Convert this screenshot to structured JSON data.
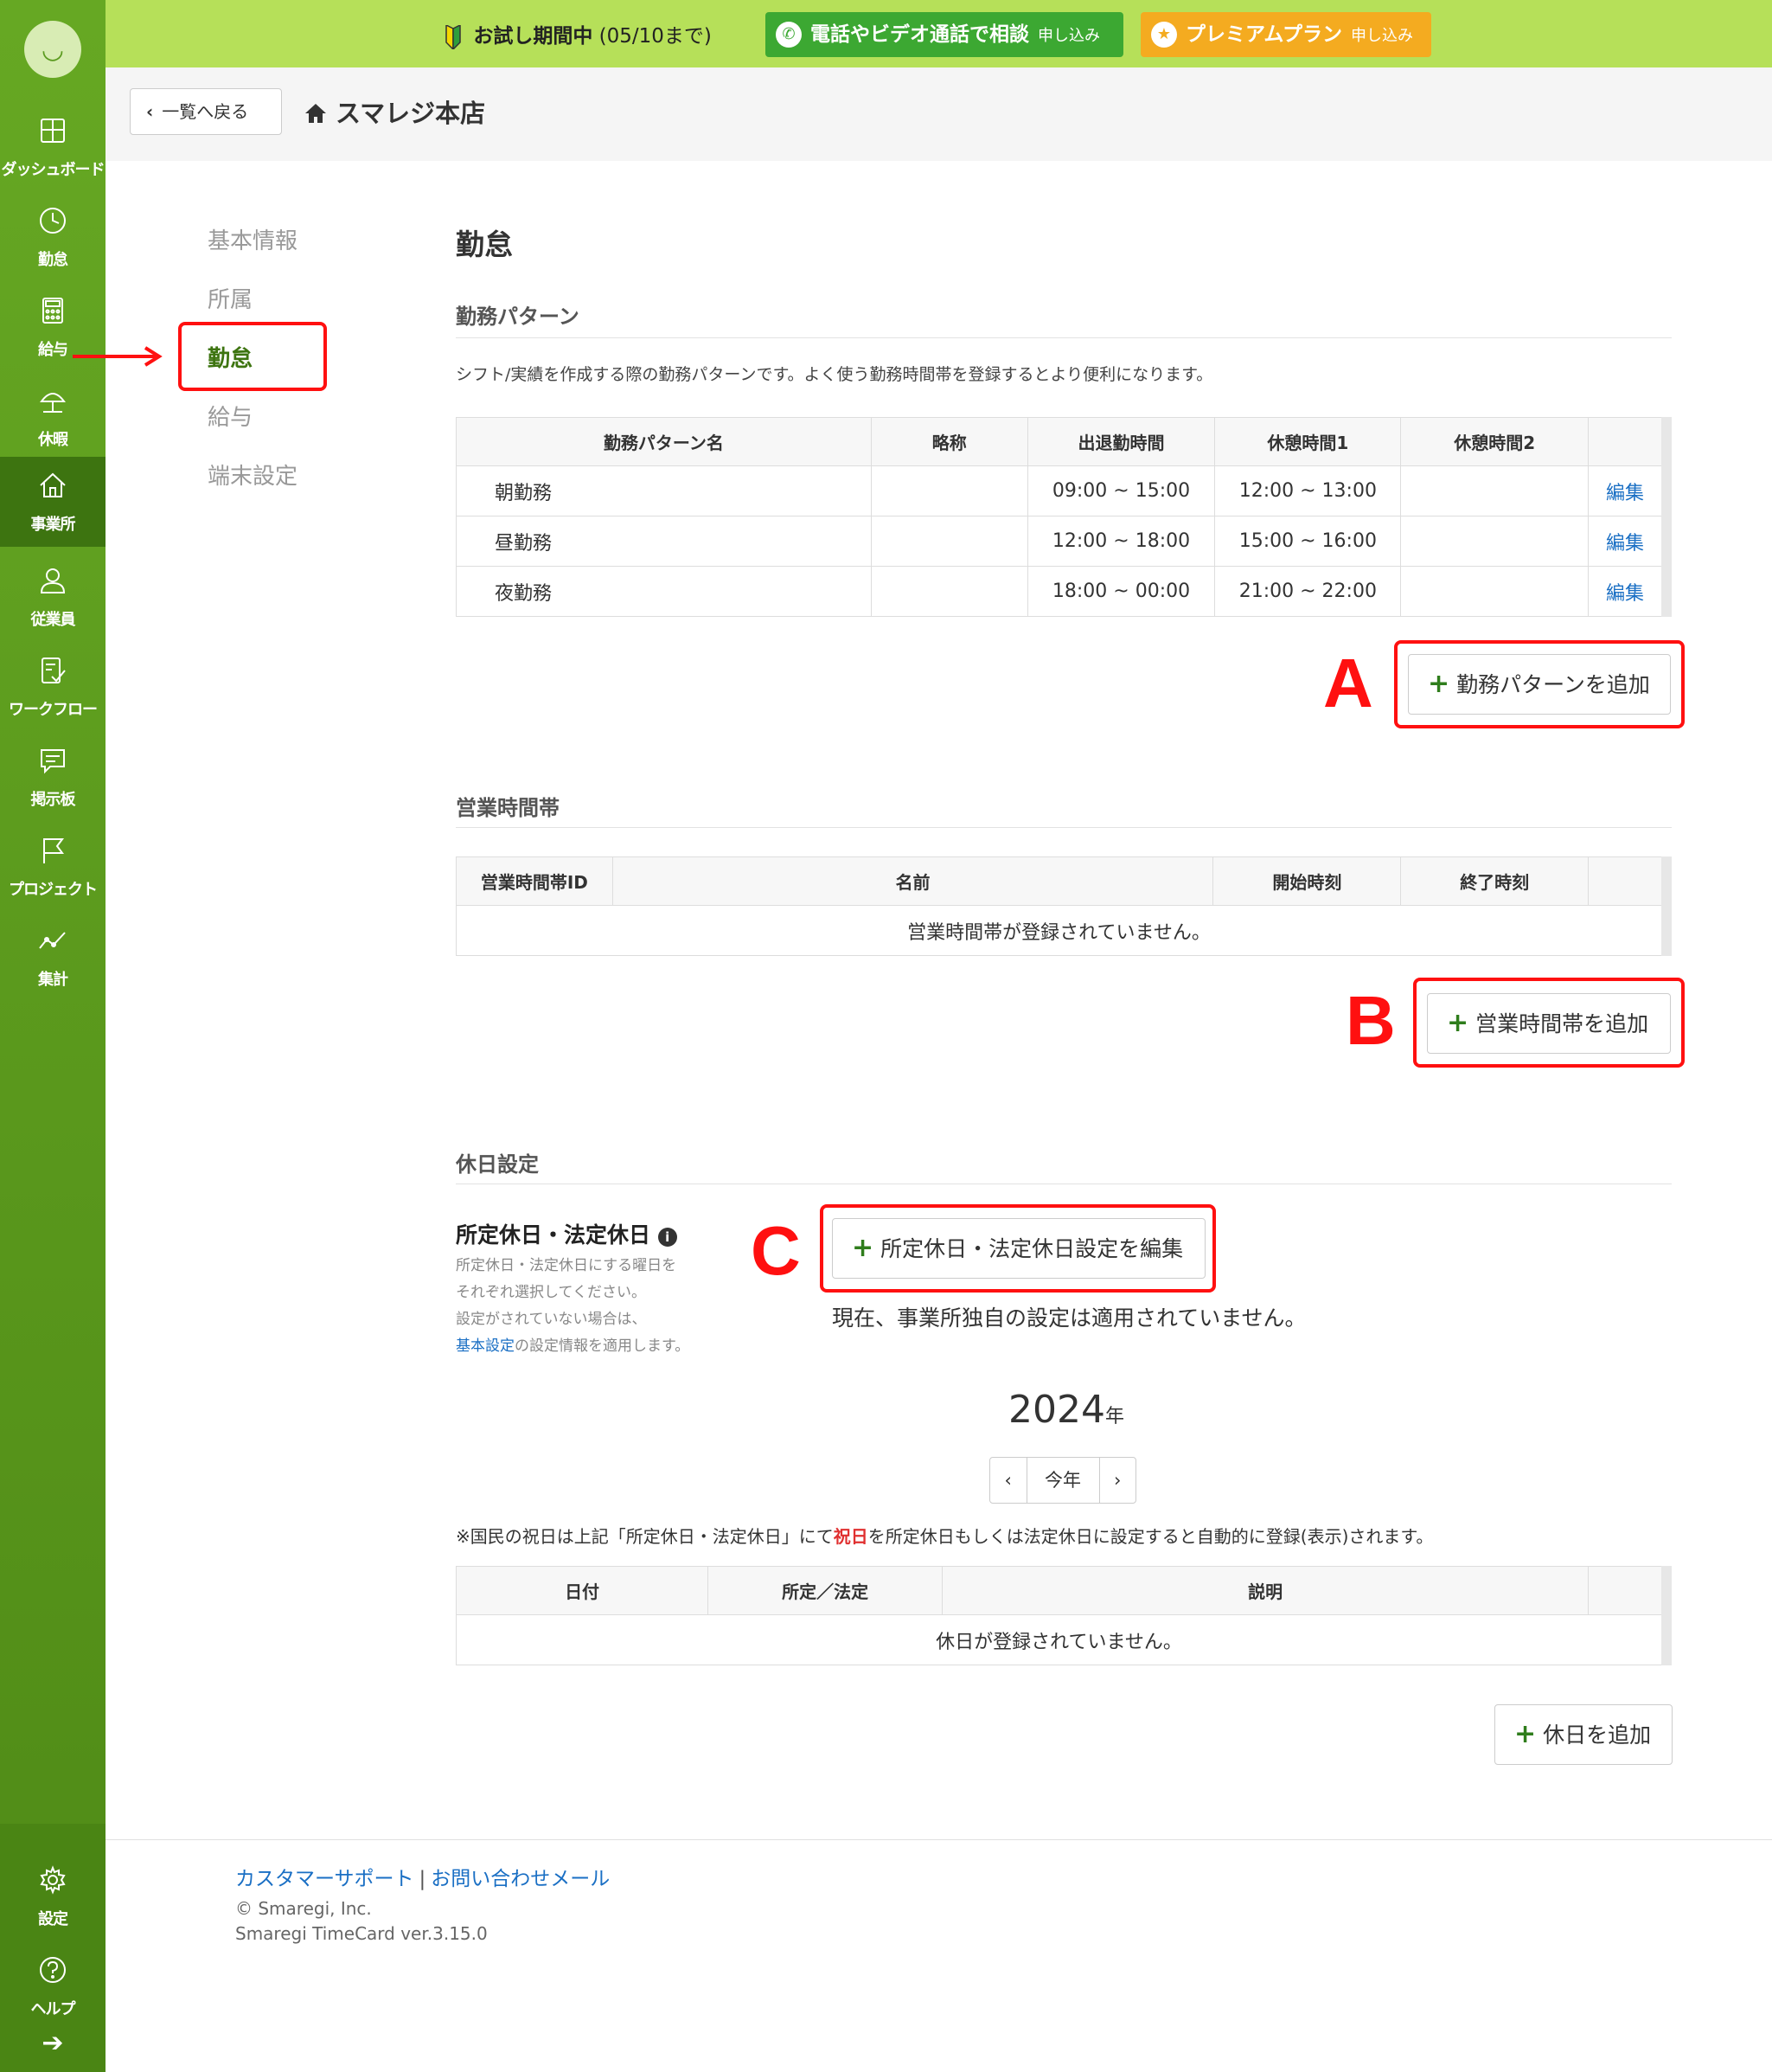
{
  "sidebar": {
    "items": [
      {
        "label": "ダッシュボード",
        "icon": "dashboard-icon"
      },
      {
        "label": "勤怠",
        "icon": "clock-icon"
      },
      {
        "label": "給与",
        "icon": "calculator-icon"
      },
      {
        "label": "休暇",
        "icon": "umbrella-icon"
      },
      {
        "label": "事業所",
        "icon": "home-icon"
      },
      {
        "label": "従業員",
        "icon": "person-icon"
      },
      {
        "label": "ワークフロー",
        "icon": "checklist-icon"
      },
      {
        "label": "掲示板",
        "icon": "message-icon"
      },
      {
        "label": "プロジェクト",
        "icon": "flag-icon"
      },
      {
        "label": "集計",
        "icon": "chart-line-icon"
      }
    ],
    "bottom": [
      {
        "label": "設定",
        "icon": "gear-icon"
      },
      {
        "label": "ヘルプ",
        "icon": "help-icon"
      }
    ],
    "active": "事業所"
  },
  "banner": {
    "trial_bold": "お試し期間中",
    "trial_rest": "(05/10まで)",
    "phone_label": "電話やビデオ通話で相談",
    "phone_sub": "申し込み",
    "premium_label": "プレミアムプラン",
    "premium_sub": "申し込み"
  },
  "header": {
    "back_label": "一覧へ戻る",
    "store_name": "スマレジ本店"
  },
  "submenu": {
    "items": [
      "基本情報",
      "所属",
      "勤怠",
      "給与",
      "端末設定"
    ],
    "selected": "勤怠"
  },
  "main": {
    "title": "勤怠",
    "work_patterns": {
      "section_title": "勤務パターン",
      "description": "シフト/実績を作成する際の勤務パターンです。よく使う勤務時間帯を登録するとより便利になります。",
      "columns": [
        "勤務パターン名",
        "略称",
        "出退勤時間",
        "休憩時間1",
        "休憩時間2",
        ""
      ],
      "rows": [
        {
          "name": "朝勤務",
          "abbr": "",
          "work": "09:00 ~ 15:00",
          "break1": "12:00 ~ 13:00",
          "break2": "",
          "action": "編集"
        },
        {
          "name": "昼勤務",
          "abbr": "",
          "work": "12:00 ~ 18:00",
          "break1": "15:00 ~ 16:00",
          "break2": "",
          "action": "編集"
        },
        {
          "name": "夜勤務",
          "abbr": "",
          "work": "18:00 ~ 00:00",
          "break1": "21:00 ~ 22:00",
          "break2": "",
          "action": "編集"
        }
      ],
      "add_label": "勤務パターンを追加"
    },
    "business_hours": {
      "section_title": "営業時間帯",
      "columns": [
        "営業時間帯ID",
        "名前",
        "開始時刻",
        "終了時刻",
        ""
      ],
      "empty": "営業時間帯が登録されていません。",
      "add_label": "営業時間帯を追加"
    },
    "holidays": {
      "section_title": "休日設定",
      "heading": "所定休日・法定休日",
      "note_line1": "所定休日・法定休日にする曜日を",
      "note_line2": "それぞれ選択してください。",
      "note_line3": "設定がされていない場合は、",
      "note_link": "基本設定",
      "note_line4": "の設定情報を適用します。",
      "edit_label": "所定休日・法定休日設定を編集",
      "current_note": "現在、事業所独自の設定は適用されていません。",
      "year": "2024",
      "year_unit": "年",
      "this_year": "今年",
      "national_pre": "※国民の祝日は上記「所定休日・法定休日」にて",
      "national_red": "祝日",
      "national_post": "を所定休日もしくは法定休日に設定すると自動的に登録(表示)されます。",
      "columns": [
        "日付",
        "所定／法定",
        "説明",
        ""
      ],
      "empty": "休日が登録されていません。",
      "add_label": "休日を追加"
    }
  },
  "annotations": {
    "a": "A",
    "b": "B",
    "c": "C"
  },
  "footer": {
    "support": "カスタマーサポート",
    "separator": "|",
    "contact": "お問い合わせメール",
    "copyright": "© Smaregi, Inc.",
    "version": "Smaregi TimeCard ver.3.15.0"
  },
  "colors": {
    "sidebar": "#5b9b1d",
    "banner": "#b6e059",
    "accent_red": "#ff1010",
    "link": "#1a6fc4"
  }
}
